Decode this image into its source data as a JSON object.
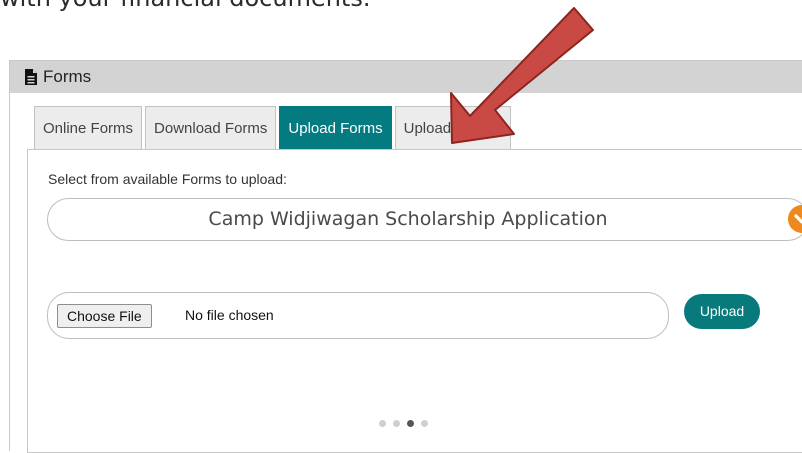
{
  "intro_text": "with your financial documents.",
  "panel": {
    "title": "Forms",
    "icon": "document-icon"
  },
  "tabs": [
    {
      "label": "Online Forms",
      "active": false
    },
    {
      "label": "Download Forms",
      "active": false
    },
    {
      "label": "Upload Forms",
      "active": true
    },
    {
      "label": "Upload History",
      "active": false
    }
  ],
  "upload": {
    "select_label": "Select from available Forms to upload:",
    "selected_form": "Camp Widjiwagan Scholarship Application",
    "choose_file_label": "Choose File",
    "file_status": "No file chosen",
    "upload_button": "Upload"
  },
  "pager": {
    "total": 4,
    "current": 3
  },
  "colors": {
    "accent": "#047b80",
    "dropdown_icon": "#ee8a1d",
    "annotation_arrow": "#c94a45"
  }
}
